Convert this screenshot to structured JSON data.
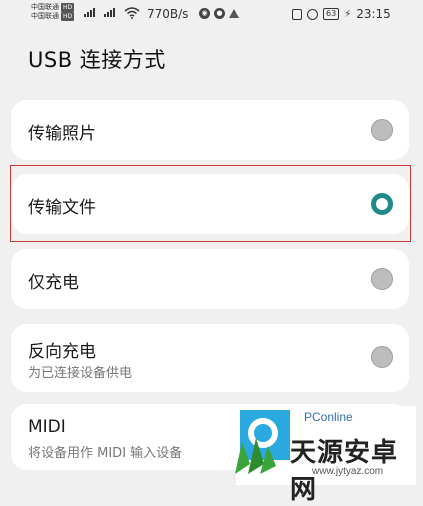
{
  "status_bar": {
    "carrier_1": "中国联通",
    "carrier_2": "中国联通",
    "hd_badge": "HD",
    "net_speed": "770B/s",
    "battery": "63",
    "time": "23:15"
  },
  "page": {
    "title": "USB 连接方式"
  },
  "options": [
    {
      "label": "传输照片",
      "selected": false
    },
    {
      "label": "传输文件",
      "selected": true
    },
    {
      "label": "仅充电",
      "selected": false
    },
    {
      "label": "反向充电",
      "subtitle": "为已连接设备供电",
      "selected": false
    },
    {
      "label": "MIDI",
      "subtitle": "将设备用作 MIDI 输入设备"
    }
  ],
  "watermark": {
    "brand_small": "PConline",
    "brand": "天源安卓网",
    "url": "www.jytyaz.com"
  },
  "colors": {
    "accent": "#1f8a8a",
    "highlight": "#c4383a"
  }
}
